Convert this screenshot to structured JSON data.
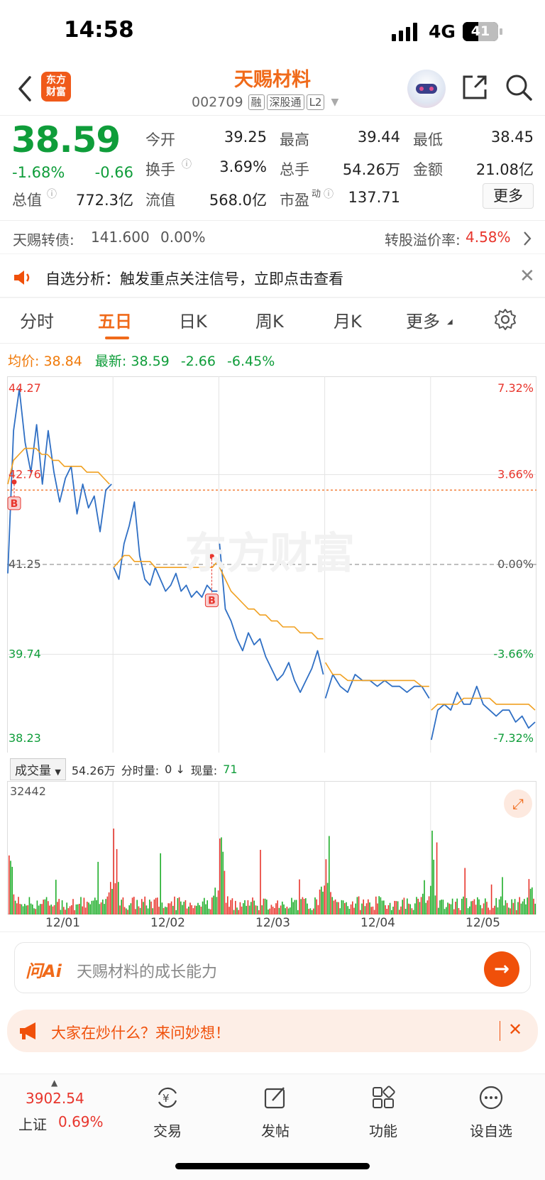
{
  "status_bar": {
    "time": "14:58",
    "network": "4G",
    "battery": "41"
  },
  "nav": {
    "title": "天赐材料",
    "code": "002709",
    "tags": [
      "融",
      "深股通",
      "L2"
    ]
  },
  "quote": {
    "price": "38.59",
    "change_pct": "-1.68%",
    "change": "-0.66",
    "rows": [
      [
        {
          "label": "今开",
          "value": "39.25",
          "color": "#222222"
        },
        {
          "label": "最高",
          "value": "39.44",
          "color": "#e8352c"
        },
        {
          "label": "最低",
          "value": "38.45",
          "color": "#0f9d3a"
        }
      ],
      [
        {
          "label": "换手",
          "value": "3.69%",
          "color": "#222222"
        },
        {
          "label": "总手",
          "value": "54.26万",
          "color": "#222222"
        },
        {
          "label": "金额",
          "value": "21.08亿",
          "color": "#222222"
        }
      ],
      [
        {
          "label": "流值",
          "value": "568.0亿",
          "color": "#222222"
        },
        {
          "label": "市盈",
          "value": "137.71",
          "color": "#222222"
        }
      ]
    ],
    "total_value_label": "总值",
    "total_value": "772.3亿",
    "pe_sup": "动",
    "more_label": "更多"
  },
  "bond": {
    "name": "天赐转债:",
    "price": "141.600",
    "change": "0.00%",
    "premium_label": "转股溢价率:",
    "premium": "4.58%"
  },
  "notice": {
    "text": "自选分析：触发重点关注信号，立即点击查看"
  },
  "tabs": [
    "分时",
    "五日",
    "日K",
    "周K",
    "月K",
    "更多"
  ],
  "info_line": {
    "avg_label": "均价:",
    "avg": "38.84",
    "latest_label": "最新:",
    "latest": "38.59",
    "change": "-2.66",
    "change_pct": "-6.45%"
  },
  "chart_data": {
    "type": "line",
    "title": "",
    "x": [
      "12/01",
      "12/02",
      "12/03",
      "12/04",
      "12/05"
    ],
    "y_ticks": [
      "44.27",
      "42.76",
      "41.25",
      "39.74",
      "38.23"
    ],
    "pct_ticks": [
      "7.32%",
      "3.66%",
      "0.00%",
      "-3.66%",
      "-7.32%"
    ],
    "ylim": [
      38.23,
      44.27
    ],
    "prev_close": 41.25,
    "markers": [
      "B",
      "B"
    ],
    "series": [
      {
        "name": "最新",
        "color": "#2f6fc4",
        "values": [
          41.1,
          43.5,
          44.2,
          43.3,
          42.8,
          43.6,
          42.6,
          43.5,
          42.8,
          42.3,
          42.7,
          42.9,
          42.1,
          42.6,
          42.2,
          42.4,
          41.8,
          42.5,
          42.6,
          41.2,
          41.0,
          41.6,
          41.9,
          42.3,
          41.4,
          41.0,
          40.9,
          41.2,
          41.0,
          40.8,
          40.9,
          41.1,
          40.8,
          40.9,
          40.7,
          40.8,
          40.7,
          40.9,
          40.8,
          40.8,
          41.6,
          40.5,
          40.3,
          40.0,
          39.8,
          40.1,
          39.9,
          40.0,
          39.7,
          39.5,
          39.3,
          39.4,
          39.6,
          39.3,
          39.1,
          39.3,
          39.5,
          39.8,
          39.4,
          39.0,
          39.4,
          39.2,
          39.1,
          39.4,
          39.3,
          39.3,
          39.2,
          39.3,
          39.2,
          39.2,
          39.1,
          39.2,
          39.2,
          39.0,
          38.3,
          38.8,
          38.9,
          38.8,
          39.1,
          38.9,
          38.9,
          39.2,
          38.9,
          38.8,
          38.7,
          38.8,
          38.8,
          38.6,
          38.7,
          38.5,
          38.6
        ]
      },
      {
        "name": "均价",
        "color": "#f0a020",
        "values": [
          42.6,
          43.0,
          43.1,
          43.2,
          43.2,
          43.2,
          43.1,
          43.1,
          43.0,
          43.0,
          42.9,
          42.9,
          42.9,
          42.9,
          42.8,
          42.8,
          42.8,
          42.7,
          42.6,
          41.2,
          41.3,
          41.4,
          41.4,
          41.3,
          41.3,
          41.3,
          41.3,
          41.2,
          41.2,
          41.2,
          41.2,
          41.2,
          41.2,
          41.2,
          41.2,
          41.2,
          41.2,
          41.2,
          41.2,
          41.3,
          41.2,
          41.0,
          40.8,
          40.7,
          40.6,
          40.5,
          40.5,
          40.4,
          40.4,
          40.3,
          40.3,
          40.2,
          40.2,
          40.2,
          40.1,
          40.1,
          40.1,
          40.0,
          40.0,
          39.6,
          39.4,
          39.4,
          39.3,
          39.3,
          39.3,
          39.3,
          39.3,
          39.3,
          39.3,
          39.3,
          39.3,
          39.3,
          39.2,
          39.2,
          38.8,
          38.9,
          38.9,
          38.9,
          38.9,
          39.0,
          39.0,
          39.0,
          39.0,
          39.0,
          38.9,
          38.9,
          38.9,
          38.9,
          38.9,
          38.9,
          38.8
        ]
      }
    ]
  },
  "volume": {
    "selector": "成交量",
    "total": "54.26万",
    "minute_label": "分时量:",
    "minute_value": "0 ↓",
    "now_label": "现量:",
    "now_value": "71",
    "max_label": "32442"
  },
  "ai": {
    "logo": "问Ai",
    "placeholder": "天赐材料的成长能力"
  },
  "promo": {
    "text": "大家在炒什么？来问妙想！"
  },
  "bottom_nav": {
    "index_value": "3902.54",
    "index_name": "上证",
    "index_change": "0.69%",
    "items": [
      "交易",
      "发帖",
      "功能",
      "设自选"
    ]
  },
  "colors": {
    "accent": "#f06a1a",
    "up": "#e8352c",
    "down": "#0f9d3a",
    "price_line": "#2f6fc4",
    "avg_line": "#f0a020"
  }
}
